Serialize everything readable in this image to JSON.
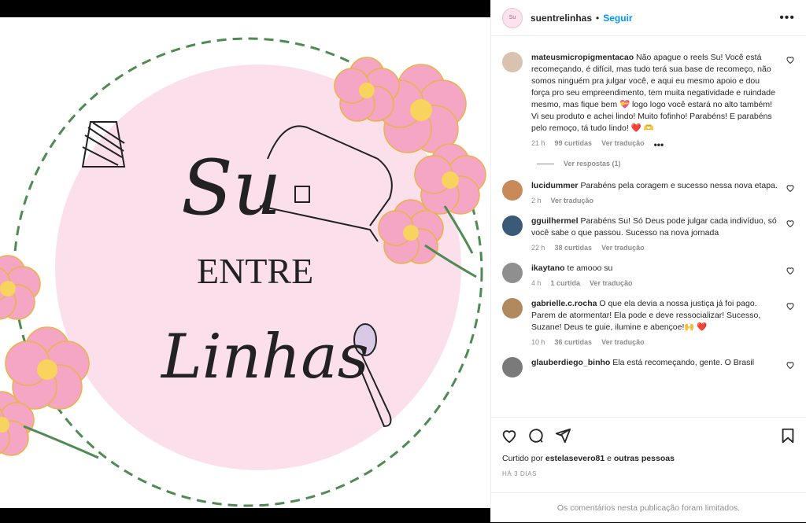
{
  "post": {
    "author": "suentrelinhas",
    "separator": "•",
    "follow_label": "Seguir",
    "more_label": "•••",
    "image_art": {
      "title_top": "Su",
      "title_mid": "ENTRE",
      "title_bottom": "Linhas"
    }
  },
  "comments": [
    {
      "user": "mateusmicropigmentacao",
      "text": "Não apague o reels Su! Você está recomeçando, é difícil, mas tudo terá sua base de recomeço, não somos ninguém pra julgar você, e aqui eu mesmo apoio e dou força pro seu empreendimento, tem muita negatividade e ruindade mesmo, mas fique bem 💝 logo logo você estará no alto também! Vi seu produto e achei lindo! Muito fofinho! Parabéns! E parabéns pelo remoço, tá tudo lindo! ❤️ 🫶",
      "time": "21 h",
      "likes": "99 curtidas",
      "translate": "Ver tradução",
      "options": "•••",
      "avatar_color": "#d9c3b0"
    },
    {
      "user": "lucidummer",
      "text": "Parabéns pela coragem e sucesso nessa nova etapa.",
      "time": "2 h",
      "likes": "",
      "translate": "Ver tradução",
      "avatar_color": "#c98a5a"
    },
    {
      "user": "gguilhermel",
      "text": "Parabéns Su! Só Deus pode julgar cada indivíduo, só você sabe o que passou. Sucesso na nova jornada",
      "time": "22 h",
      "likes": "38 curtidas",
      "translate": "Ver tradução",
      "avatar_color": "#3a5a78"
    },
    {
      "user": "ikaytano",
      "text": "te amooo su",
      "time": "4 h",
      "likes": "1 curtida",
      "translate": "Ver tradução",
      "avatar_color": "#8f8f8f"
    },
    {
      "user": "gabrielle.c.rocha",
      "text": "O que ela devia a nossa justiça já foi pago. Parem de atormentar! Ela pode e deve ressocializar! Sucesso, Suzane! Deus te guie, ilumine e abençoe!🙌 ❤️",
      "time": "10 h",
      "likes": "36 curtidas",
      "translate": "Ver tradução",
      "avatar_color": "#b08a5e"
    },
    {
      "user": "glauberdiego_binho",
      "text": "Ela está recomeçando, gente. O Brasil",
      "time": "",
      "likes": "",
      "translate": "",
      "avatar_color": "#7a7a7a"
    }
  ],
  "view_replies": "Ver respostas (1)",
  "liked_by": {
    "prefix": "Curtido por",
    "user": "estelasevero81",
    "middle": "e",
    "others": "outras pessoas"
  },
  "date": "HÁ 3 DIAS",
  "limited_notice": "Os comentários nesta publicação foram limitados.",
  "icons": [
    "heart-icon",
    "comment-icon",
    "share-icon",
    "bookmark-icon",
    "more-icon"
  ],
  "colors": {
    "accent": "#0095f6",
    "pink_circle": "#fbe0ec",
    "flower": "#f4a6c4",
    "text": "#262626",
    "muted": "#8e8e8e"
  }
}
